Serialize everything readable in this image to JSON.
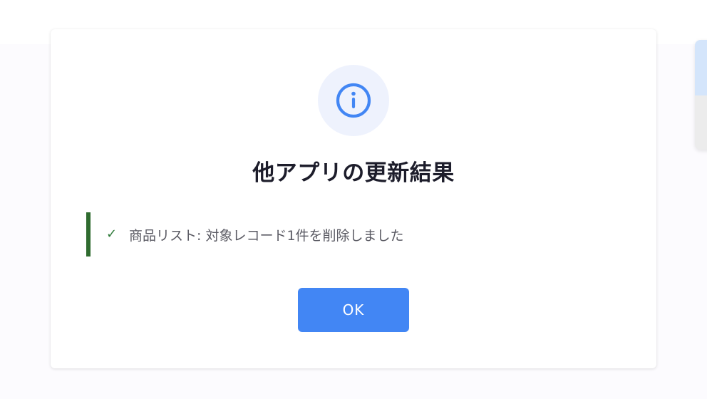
{
  "dialog": {
    "icon": "info-icon",
    "title": "他アプリの更新結果",
    "results": [
      {
        "status_icon": "check-icon",
        "status_glyph": "✓",
        "text": "商品リスト: 対象レコード1件を削除しました"
      }
    ],
    "ok_label": "OK"
  },
  "colors": {
    "accent": "#4286f4",
    "success": "#2f6b2f",
    "icon_bg": "#eef2fd"
  }
}
